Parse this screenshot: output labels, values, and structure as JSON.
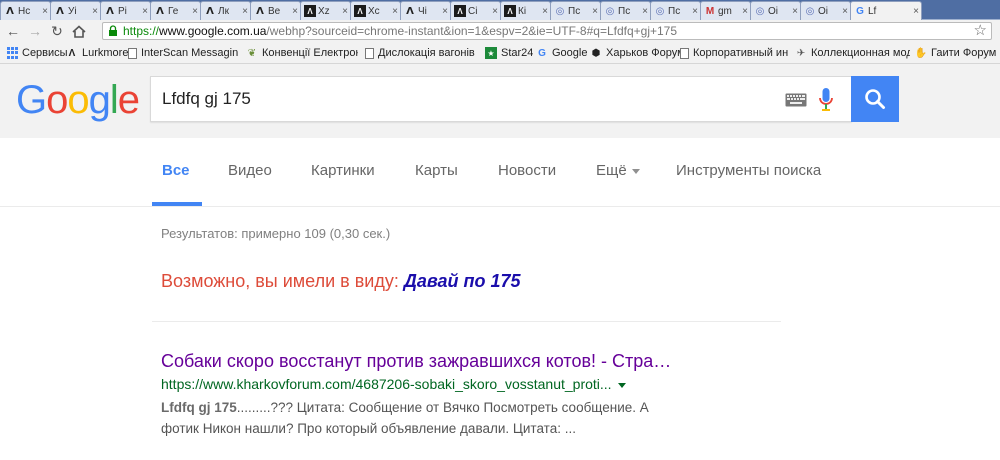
{
  "browser": {
    "tabs": [
      {
        "label": "Hc",
        "icon": "lurkmore-icon"
      },
      {
        "label": "Уі",
        "icon": "lurkmore-icon"
      },
      {
        "label": "Рі",
        "icon": "lurkmore-icon"
      },
      {
        "label": "Ге",
        "icon": "lurkmore-icon"
      },
      {
        "label": "Лк",
        "icon": "lurkmore-icon"
      },
      {
        "label": "Ве",
        "icon": "lurkmore-icon"
      },
      {
        "label": "Xz",
        "icon": "dark-site-icon"
      },
      {
        "label": "Xc",
        "icon": "dark-site-icon"
      },
      {
        "label": "Чі",
        "icon": "lurkmore-icon"
      },
      {
        "label": "Сі",
        "icon": "dark-site-icon"
      },
      {
        "label": "Кі",
        "icon": "dark-site-icon"
      },
      {
        "label": "Пс",
        "icon": "opera-icon"
      },
      {
        "label": "Пс",
        "icon": "opera-icon"
      },
      {
        "label": "Пс",
        "icon": "opera-icon"
      },
      {
        "label": "gm",
        "icon": "gmail-icon"
      },
      {
        "label": "Oi",
        "icon": "opera-icon"
      },
      {
        "label": "Oi",
        "icon": "opera-icon"
      },
      {
        "label": "Lf",
        "icon": "google-icon",
        "active": true
      }
    ],
    "url": {
      "scheme": "https://",
      "host": "www.google.com.ua",
      "path": "/webhp?sourceid=chrome-instant&ion=1&espv=2&ie=UTF-8#q=Lfdfq+gj+175"
    },
    "bookmarks": [
      {
        "label": "Сервисы",
        "icon": "apps-icon"
      },
      {
        "label": "Lurkmore",
        "icon": "lurkmore-icon"
      },
      {
        "label": "InterScan Messaging Se",
        "icon": "page-icon"
      },
      {
        "label": "Конвенції Електронни",
        "icon": "leaf-icon"
      },
      {
        "label": "Дислокація вагонів По",
        "icon": "page-icon"
      },
      {
        "label": "Star24",
        "icon": "star24-icon"
      },
      {
        "label": "Google",
        "icon": "google-icon"
      },
      {
        "label": "Харьков Форум",
        "icon": "forum-icon"
      },
      {
        "label": "Корпоративный инфор",
        "icon": "page-icon"
      },
      {
        "label": "Коллекционная модель",
        "icon": "bird-icon"
      },
      {
        "label": "Гаити Форум",
        "icon": "hand-icon"
      }
    ]
  },
  "search": {
    "logo_letters": [
      "G",
      "o",
      "o",
      "g",
      "l",
      "e"
    ],
    "query": "Lfdfq gj 175"
  },
  "nav": {
    "tabs": [
      "Все",
      "Видео",
      "Картинки",
      "Карты",
      "Новости",
      "Ещё",
      "Инструменты поиска"
    ],
    "active": "Все"
  },
  "results": {
    "stats": "Результатов: примерно 109 (0,30 сек.)",
    "did_you_mean_prefix": "Возможно, вы имели в виду:",
    "did_you_mean_suggestion": "Давай по 175",
    "items": [
      {
        "title": "Собаки скоро восстанут против зажравшихся котов! - Стра…",
        "url": "https://www.kharkovforum.com/4687206-sobaki_skoro_vosstanut_proti...",
        "snippet_bold": "Lfdfq gj 175",
        "snippet_line1": ".........??? Цитата: Сообщение от Вячко Посмотреть сообщение. А",
        "snippet_line2": "фотик Никон нашли? Про который объявление давали. Цитата: ..."
      }
    ]
  },
  "colors": {
    "google_blue": "#4285f4",
    "red": "#dd4b39",
    "visited_link": "#660099",
    "link": "#1a0dab",
    "url_green": "#006621"
  }
}
